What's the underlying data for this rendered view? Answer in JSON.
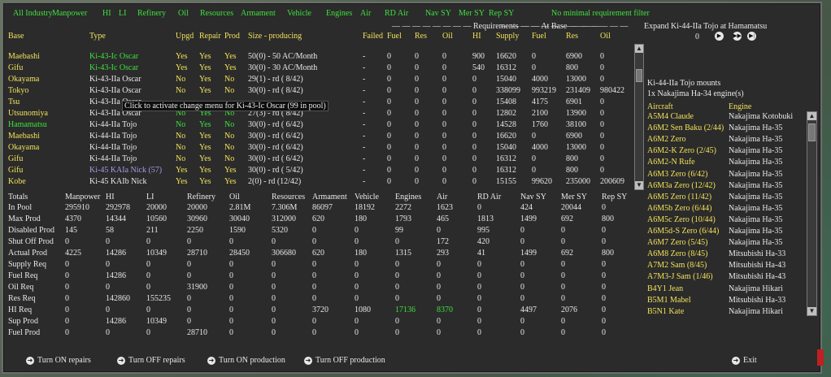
{
  "filters": [
    "All Industry",
    "Manpower",
    "HI",
    "LI",
    "Refinery",
    "Oil",
    "Resources",
    "Armament",
    "Vehicle",
    "Engines",
    "Air",
    "RD Air",
    "Nav SY",
    "Mer SY",
    "Rep SY",
    "No minimal requirement filter"
  ],
  "group_headers": {
    "requirements": "Requirements",
    "at_base": "At Base"
  },
  "columns": [
    "Base",
    "Type",
    "Upgd",
    "Repair",
    "Prod",
    "Size - producing",
    "Failed",
    "Fuel",
    "Res",
    "Oil",
    "HI",
    "Supply",
    "Fuel",
    "Res",
    "Oil"
  ],
  "factories": [
    {
      "base": "Maebashi",
      "type": "Ki-43-Ic Oscar",
      "upgd": "Yes",
      "repair": "Yes",
      "prod": "Yes",
      "size": "50(0) - 50 AC/Month",
      "failed": "-",
      "fuel": "0",
      "res": "0",
      "oil": "0",
      "hi": "900",
      "supply": "16620",
      "b_fuel": "0",
      "b_res": "6900",
      "b_oil": "0",
      "base_c": "y",
      "type_c": "g",
      "upgd_c": "y",
      "repair_c": "y",
      "prod_c": "y"
    },
    {
      "base": "Gifu",
      "type": "Ki-43-Ic Oscar",
      "upgd": "Yes",
      "repair": "Yes",
      "prod": "Yes",
      "size": "30(0) - 30 AC/Month",
      "failed": "-",
      "fuel": "0",
      "res": "0",
      "oil": "0",
      "hi": "540",
      "supply": "16312",
      "b_fuel": "0",
      "b_res": "800",
      "b_oil": "0",
      "base_c": "y",
      "type_c": "g",
      "upgd_c": "y",
      "repair_c": "y",
      "prod_c": "y"
    },
    {
      "base": "Okayama",
      "type": "Ki-43-IIa Oscar",
      "upgd": "No",
      "repair": "Yes",
      "prod": "No",
      "size": "29(1) - rd ( 8/42)",
      "failed": "-",
      "fuel": "0",
      "res": "0",
      "oil": "0",
      "hi": "0",
      "supply": "15040",
      "b_fuel": "4000",
      "b_res": "13000",
      "b_oil": "0",
      "base_c": "y",
      "type_c": "w",
      "upgd_c": "y",
      "repair_c": "y",
      "prod_c": "y"
    },
    {
      "base": "Tokyo",
      "type": "Ki-43-IIa Oscar",
      "upgd": "No",
      "repair": "Yes",
      "prod": "No",
      "size": "30(0) - rd ( 8/42)",
      "failed": "-",
      "fuel": "0",
      "res": "0",
      "oil": "0",
      "hi": "0",
      "supply": "338099",
      "b_fuel": "993219",
      "b_res": "231409",
      "b_oil": "980422",
      "base_c": "y",
      "type_c": "w",
      "upgd_c": "y",
      "repair_c": "y",
      "prod_c": "y"
    },
    {
      "base": "Tsu",
      "type": "Ki-43-IIa Oscar",
      "upgd": "",
      "repair": "",
      "prod": "",
      "size": "",
      "failed": "-",
      "fuel": "0",
      "res": "0",
      "oil": "0",
      "hi": "0",
      "supply": "15408",
      "b_fuel": "4175",
      "b_res": "6901",
      "b_oil": "0",
      "base_c": "y",
      "type_c": "w",
      "upgd_c": "y",
      "repair_c": "y",
      "prod_c": "y"
    },
    {
      "base": "Utsunomiya",
      "type": "Ki-43-IIa Oscar",
      "upgd": "No",
      "repair": "Yes",
      "prod": "No",
      "size": "27(3) - rd ( 8/42)",
      "failed": "-",
      "fuel": "0",
      "res": "0",
      "oil": "0",
      "hi": "0",
      "supply": "12802",
      "b_fuel": "2100",
      "b_res": "13900",
      "b_oil": "0",
      "base_c": "y",
      "type_c": "w",
      "upgd_c": "g",
      "repair_c": "g",
      "prod_c": "g"
    },
    {
      "base": "Hamamatsu",
      "type": "Ki-44-IIa Tojo",
      "upgd": "No",
      "repair": "Yes",
      "prod": "No",
      "size": "30(0) - rd ( 6/42)",
      "failed": "-",
      "fuel": "0",
      "res": "0",
      "oil": "0",
      "hi": "0",
      "supply": "14528",
      "b_fuel": "1760",
      "b_res": "38100",
      "b_oil": "0",
      "base_c": "g",
      "type_c": "w",
      "upgd_c": "g",
      "repair_c": "g",
      "prod_c": "g"
    },
    {
      "base": "Maebashi",
      "type": "Ki-44-IIa Tojo",
      "upgd": "No",
      "repair": "Yes",
      "prod": "No",
      "size": "30(0) - rd ( 6/42)",
      "failed": "-",
      "fuel": "0",
      "res": "0",
      "oil": "0",
      "hi": "0",
      "supply": "16620",
      "b_fuel": "0",
      "b_res": "6900",
      "b_oil": "0",
      "base_c": "y",
      "type_c": "w",
      "upgd_c": "y",
      "repair_c": "y",
      "prod_c": "y"
    },
    {
      "base": "Okayama",
      "type": "Ki-44-IIa Tojo",
      "upgd": "No",
      "repair": "Yes",
      "prod": "No",
      "size": "30(0) - rd ( 6/42)",
      "failed": "-",
      "fuel": "0",
      "res": "0",
      "oil": "0",
      "hi": "0",
      "supply": "15040",
      "b_fuel": "4000",
      "b_res": "13000",
      "b_oil": "0",
      "base_c": "y",
      "type_c": "w",
      "upgd_c": "y",
      "repair_c": "y",
      "prod_c": "y"
    },
    {
      "base": "Gifu",
      "type": "Ki-44-IIa Tojo",
      "upgd": "No",
      "repair": "Yes",
      "prod": "No",
      "size": "30(0) - rd ( 6/42)",
      "failed": "-",
      "fuel": "0",
      "res": "0",
      "oil": "0",
      "hi": "0",
      "supply": "16312",
      "b_fuel": "0",
      "b_res": "800",
      "b_oil": "0",
      "base_c": "y",
      "type_c": "w",
      "upgd_c": "y",
      "repair_c": "y",
      "prod_c": "y"
    },
    {
      "base": "Gifu",
      "type": "Ki-45 KAIa Nick (57)",
      "upgd": "Yes",
      "repair": "Yes",
      "prod": "Yes",
      "size": "30(0) - rd ( 5/42)",
      "failed": "-",
      "fuel": "0",
      "res": "0",
      "oil": "0",
      "hi": "0",
      "supply": "16312",
      "b_fuel": "0",
      "b_res": "800",
      "b_oil": "0",
      "base_c": "y",
      "type_c": "p",
      "upgd_c": "y",
      "repair_c": "y",
      "prod_c": "y"
    },
    {
      "base": "Kobe",
      "type": "Ki-45 KAIb Nick",
      "upgd": "Yes",
      "repair": "Yes",
      "prod": "Yes",
      "size": "2(0) - rd (12/42)",
      "failed": "-",
      "fuel": "0",
      "res": "0",
      "oil": "0",
      "hi": "0",
      "supply": "15155",
      "b_fuel": "99620",
      "b_res": "235000",
      "b_oil": "200609",
      "base_c": "y",
      "type_c": "w",
      "upgd_c": "y",
      "repair_c": "y",
      "prod_c": "y"
    }
  ],
  "tooltip": "Click to activate change menu for Ki-43-Ic Oscar (99 in pool)",
  "totals_headers": [
    "Totals",
    "Manpower",
    "HI",
    "LI",
    "Refinery",
    "Oil",
    "Resources",
    "Armament",
    "Vehicle",
    "Engines",
    "Air",
    "RD Air",
    "Nav SY",
    "Mer SY",
    "Rep SY"
  ],
  "totals_rows": [
    [
      "In Pool",
      "295910",
      "292978",
      "20000",
      "20000",
      "2.81M",
      "7.306M",
      "86097",
      "18192",
      "2272",
      "1623",
      "0",
      "424",
      "20044",
      "0"
    ],
    [
      "Max Prod",
      "4370",
      "14344",
      "10560",
      "30960",
      "30040",
      "312000",
      "620",
      "180",
      "1793",
      "465",
      "1813",
      "1499",
      "692",
      "800"
    ],
    [
      "Disabled Prod",
      "145",
      "58",
      "211",
      "2250",
      "1590",
      "5320",
      "0",
      "0",
      "99",
      "0",
      "995",
      "0",
      "0",
      "0"
    ],
    [
      "Shut Off Prod",
      "0",
      "0",
      "0",
      "0",
      "0",
      "0",
      "0",
      "0",
      "0",
      "172",
      "420",
      "0",
      "0",
      "0"
    ],
    [
      "Actual Prod",
      "4225",
      "14286",
      "10349",
      "28710",
      "28450",
      "306680",
      "620",
      "180",
      "1315",
      "293",
      "41",
      "1499",
      "692",
      "800"
    ],
    [
      "Supply Req",
      "0",
      "0",
      "0",
      "0",
      "0",
      "0",
      "0",
      "0",
      "0",
      "0",
      "0",
      "0",
      "0",
      "0"
    ],
    [
      "Fuel Req",
      "0",
      "14286",
      "0",
      "0",
      "0",
      "0",
      "0",
      "0",
      "0",
      "0",
      "0",
      "0",
      "0",
      "0"
    ],
    [
      "Oil Req",
      "0",
      "0",
      "0",
      "31900",
      "0",
      "0",
      "0",
      "0",
      "0",
      "0",
      "0",
      "0",
      "0",
      "0"
    ],
    [
      "Res Req",
      "0",
      "142860",
      "155235",
      "0",
      "0",
      "0",
      "0",
      "0",
      "0",
      "0",
      "0",
      "0",
      "0",
      "0"
    ],
    [
      "HI Req",
      "0",
      "0",
      "0",
      "0",
      "0",
      "0",
      "3720",
      "1080",
      "17136",
      "8370",
      "0",
      "4497",
      "2076",
      "0"
    ],
    [
      "Sup Prod",
      "0",
      "14286",
      "10349",
      "0",
      "0",
      "0",
      "0",
      "0",
      "0",
      "0",
      "0",
      "0",
      "0",
      "0"
    ],
    [
      "Fuel Prod",
      "0",
      "0",
      "0",
      "28710",
      "0",
      "0",
      "0",
      "0",
      "0",
      "0",
      "0",
      "0",
      "0",
      "0"
    ]
  ],
  "side": {
    "expand_title": "Expand Ki-44-IIa Tojo at Hamamatsu",
    "counter": "0",
    "mounts_title": "Ki-44-IIa Tojo mounts",
    "mounts_detail": "1x Nakajima Ha-34 engine(s)",
    "aircraft_header": "Aircraft",
    "engine_header": "Engine",
    "aircraft": [
      {
        "name": "A5M4 Claude",
        "engine": "Nakajima Kotobuki"
      },
      {
        "name": "A6M2 Sen Baku (2/44)",
        "engine": "Nakajima Ha-35"
      },
      {
        "name": "A6M2 Zero",
        "engine": "Nakajima Ha-35"
      },
      {
        "name": "A6M2-K Zero (2/45)",
        "engine": "Nakajima Ha-35"
      },
      {
        "name": "A6M2-N Rufe",
        "engine": "Nakajima Ha-35"
      },
      {
        "name": "A6M3 Zero (6/42)",
        "engine": "Nakajima Ha-35"
      },
      {
        "name": "A6M3a Zero (12/42)",
        "engine": "Nakajima Ha-35"
      },
      {
        "name": "A6M5 Zero (11/42)",
        "engine": "Nakajima Ha-35"
      },
      {
        "name": "A6M5b Zero (6/44)",
        "engine": "Nakajima Ha-35"
      },
      {
        "name": "A6M5c Zero (10/44)",
        "engine": "Nakajima Ha-35"
      },
      {
        "name": "A6M5d-S Zero (6/44)",
        "engine": "Nakajima Ha-35"
      },
      {
        "name": "A6M7 Zero (5/45)",
        "engine": "Nakajima Ha-35"
      },
      {
        "name": "A6M8 Zero (8/45)",
        "engine": "Mitsubishi Ha-33"
      },
      {
        "name": "A7M2 Sam (8/45)",
        "engine": "Mitsubishi Ha-43"
      },
      {
        "name": "A7M3-J Sam (1/46)",
        "engine": "Mitsubishi Ha-43"
      },
      {
        "name": "B4Y1 Jean",
        "engine": "Nakajima Hikari"
      },
      {
        "name": "B5M1 Mabel",
        "engine": "Mitsubishi Ha-33"
      },
      {
        "name": "B5N1 Kate",
        "engine": "Nakajima Hikari"
      }
    ]
  },
  "buttons": {
    "repairs_on": "Turn ON repairs",
    "repairs_off": "Turn OFF repairs",
    "prod_on": "Turn ON production",
    "prod_off": "Turn OFF production",
    "exit": "Exit"
  },
  "colors": {
    "yellow": "#f2e25a",
    "green": "#3ee03e",
    "purple": "#a69ae8",
    "white": "#e8e8e8"
  }
}
